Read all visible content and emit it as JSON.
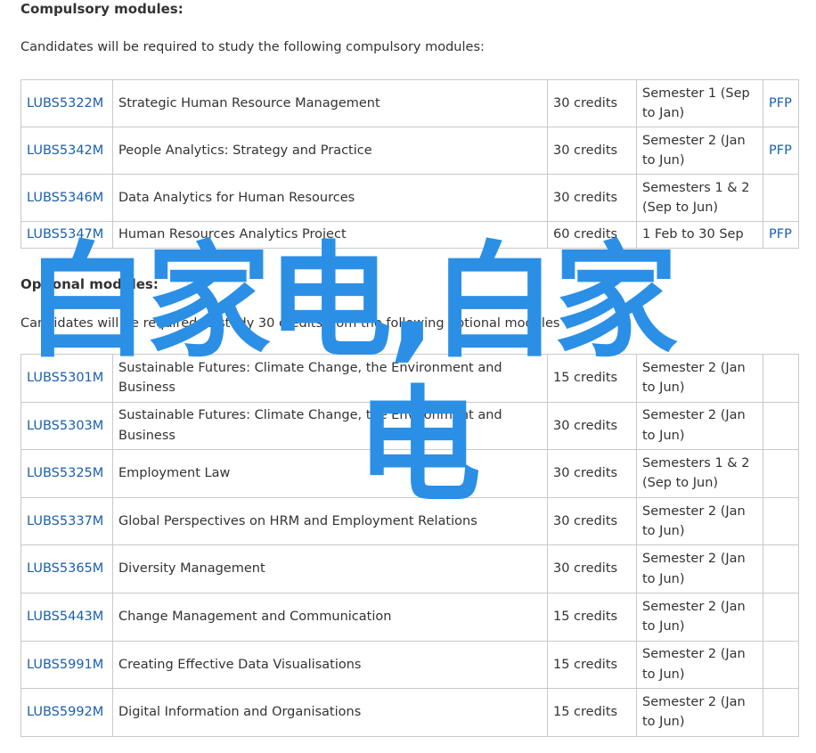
{
  "compulsory": {
    "heading": "Compulsory modules:",
    "intro": "Candidates will be required to study the following compulsory modules:",
    "rows": [
      {
        "code": "LUBS5322M",
        "title": "Strategic Human Resource Management",
        "credits": "30 credits",
        "semester": "Semester 1 (Sep to Jan)",
        "pfp": "PFP"
      },
      {
        "code": "LUBS5342M",
        "title": "People Analytics: Strategy and Practice",
        "credits": "30 credits",
        "semester": "Semester 2 (Jan to Jun)",
        "pfp": "PFP"
      },
      {
        "code": "LUBS5346M",
        "title": "Data Analytics for Human Resources",
        "credits": "30 credits",
        "semester": "Semesters 1 & 2 (Sep to Jun)",
        "pfp": ""
      },
      {
        "code": "LUBS5347M",
        "title": "Human Resources Analytics Project",
        "credits": "60 credits",
        "semester": "1 Feb to 30 Sep",
        "pfp": "PFP"
      }
    ]
  },
  "optional": {
    "heading": "Optional modules:",
    "intro": "Candidates will be required to study 30 credits from the following optional modules",
    "rows": [
      {
        "code": "LUBS5301M",
        "title": "Sustainable Futures: Climate Change, the Environment and Business",
        "credits": "15 credits",
        "semester": "Semester 2 (Jan to Jun)",
        "pfp": ""
      },
      {
        "code": "LUBS5303M",
        "title": "Sustainable Futures: Climate Change, the Environment and Business",
        "credits": "30 credits",
        "semester": "Semester 2 (Jan to Jun)",
        "pfp": ""
      },
      {
        "code": "LUBS5325M",
        "title": "Employment Law",
        "credits": "30 credits",
        "semester": "Semesters 1 & 2 (Sep to Jun)",
        "pfp": ""
      },
      {
        "code": "LUBS5337M",
        "title": "Global Perspectives on HRM and Employment Relations",
        "credits": "30 credits",
        "semester": "Semester 2 (Jan to Jun)",
        "pfp": ""
      },
      {
        "code": "LUBS5365M",
        "title": "Diversity Management",
        "credits": "30 credits",
        "semester": "Semester 2 (Jan to Jun)",
        "pfp": ""
      },
      {
        "code": "LUBS5443M",
        "title": "Change Management and Communication",
        "credits": "15 credits",
        "semester": "Semester 2 (Jan to Jun)",
        "pfp": ""
      },
      {
        "code": "LUBS5991M",
        "title": "Creating Effective Data Visualisations",
        "credits": "15 credits",
        "semester": "Semester 2 (Jan to Jun)",
        "pfp": ""
      },
      {
        "code": "LUBS5992M",
        "title": "Digital Information and Organisations",
        "credits": "15 credits",
        "semester": "Semester 2 (Jan to Jun)",
        "pfp": ""
      }
    ]
  },
  "overlay": {
    "line1": "白家电,白家",
    "line2": "电",
    "color": "#2b8fe6"
  },
  "colors": {
    "link": "#1a5fae",
    "text": "#333333",
    "border": "#c9c9c9"
  }
}
